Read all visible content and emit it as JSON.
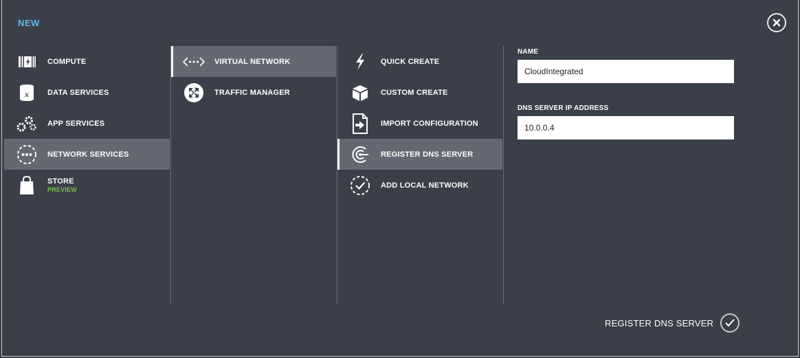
{
  "dialog": {
    "title": "NEW"
  },
  "categories": [
    {
      "label": "COMPUTE",
      "icon": "compute-icon"
    },
    {
      "label": "DATA SERVICES",
      "icon": "data-services-icon"
    },
    {
      "label": "APP SERVICES",
      "icon": "gears-icon"
    },
    {
      "label": "NETWORK SERVICES",
      "icon": "network-services-icon",
      "selected": true
    },
    {
      "label": "STORE",
      "sublabel": "PREVIEW",
      "icon": "shopping-bag-icon"
    }
  ],
  "services": [
    {
      "label": "VIRTUAL NETWORK",
      "icon": "virtual-network-icon",
      "selected": true
    },
    {
      "label": "TRAFFIC MANAGER",
      "icon": "traffic-manager-icon"
    }
  ],
  "actions": [
    {
      "label": "QUICK CREATE",
      "icon": "lightning-icon"
    },
    {
      "label": "CUSTOM CREATE",
      "icon": "box-icon"
    },
    {
      "label": "IMPORT CONFIGURATION",
      "icon": "import-icon"
    },
    {
      "label": "REGISTER DNS SERVER",
      "icon": "dns-server-icon",
      "selected": true
    },
    {
      "label": "ADD LOCAL NETWORK",
      "icon": "local-network-icon"
    }
  ],
  "form": {
    "name_label": "NAME",
    "name_value": "CloudIntegrated",
    "dns_label": "DNS SERVER IP ADDRESS",
    "dns_value": "10.0.0.4"
  },
  "submit": {
    "label": "REGISTER DNS SERVER"
  },
  "colors": {
    "background": "#3b3f49",
    "selected": "#646873",
    "title": "#5dbbe8",
    "preview": "#7cc043"
  }
}
